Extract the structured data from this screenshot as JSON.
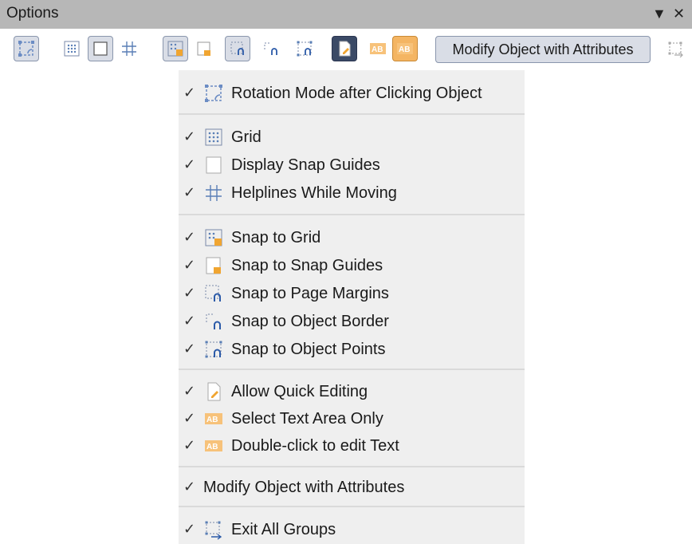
{
  "window": {
    "title": "Options",
    "dropdown_glyph": "▼",
    "close_glyph": "✕"
  },
  "toolbar": {
    "buttons": [
      {
        "name": "rotation-mode-button",
        "active": true,
        "icon": "rotation-mode-icon"
      },
      {
        "name": "grid-button",
        "active": false,
        "icon": "grid-icon"
      },
      {
        "name": "snap-guides-button",
        "active": true,
        "icon": "snap-guides-icon"
      },
      {
        "name": "helplines-button",
        "active": false,
        "icon": "helplines-icon"
      },
      {
        "name": "snap-to-grid-button",
        "active": true,
        "icon": "snap-to-grid-icon"
      },
      {
        "name": "snap-to-snap-guides-button",
        "active": false,
        "icon": "snap-to-snap-guides-icon"
      },
      {
        "name": "snap-to-page-margins-button",
        "active": true,
        "icon": "snap-to-page-margins-icon"
      },
      {
        "name": "snap-to-object-border-button",
        "active": false,
        "icon": "snap-to-object-border-icon"
      },
      {
        "name": "snap-to-object-points-button",
        "active": false,
        "icon": "snap-to-object-points-icon"
      },
      {
        "name": "allow-quick-editing-button",
        "active": true,
        "icon": "quick-edit-icon"
      },
      {
        "name": "select-text-area-only-button",
        "active": false,
        "icon": "text-area-icon"
      },
      {
        "name": "double-click-edit-text-button",
        "active": false,
        "icon": "text-edit-icon"
      },
      {
        "name": "exit-all-groups-button",
        "active": false,
        "icon": "exit-groups-icon"
      }
    ],
    "modify_label": "Modify Object with Attributes"
  },
  "menu": {
    "check_glyph": "✓",
    "items": [
      {
        "label": "Rotation Mode after Clicking Object",
        "icon": "rotation-mode-icon",
        "checked": true
      },
      {
        "label": "Grid",
        "icon": "grid-icon",
        "checked": true
      },
      {
        "label": "Display Snap Guides",
        "icon": "snap-guides-icon",
        "checked": true
      },
      {
        "label": "Helplines While Moving",
        "icon": "helplines-icon",
        "checked": true
      },
      {
        "label": "Snap to Grid",
        "icon": "snap-to-grid-icon",
        "checked": true
      },
      {
        "label": "Snap to Snap Guides",
        "icon": "snap-to-snap-guides-icon",
        "checked": true
      },
      {
        "label": "Snap to Page Margins",
        "icon": "snap-to-page-margins-icon",
        "checked": true
      },
      {
        "label": "Snap to Object Border",
        "icon": "snap-to-object-border-icon",
        "checked": true
      },
      {
        "label": "Snap to Object Points",
        "icon": "snap-to-object-points-icon",
        "checked": true
      },
      {
        "label": "Allow Quick Editing",
        "icon": "quick-edit-icon",
        "checked": true
      },
      {
        "label": "Select Text Area Only",
        "icon": "text-area-icon",
        "checked": true
      },
      {
        "label": "Double-click to edit Text",
        "icon": "text-edit-icon",
        "checked": true
      },
      {
        "label": "Modify Object with Attributes",
        "icon": "",
        "checked": true
      },
      {
        "label": "Exit All Groups",
        "icon": "exit-groups-icon",
        "checked": true
      }
    ]
  },
  "colors": {
    "titlebar": "#b7b7b7",
    "menu_bg": "#efefef",
    "active_bg": "#d9dde6",
    "active_border": "#8a96ad",
    "icon_blue": "#5a7fb6",
    "icon_orange": "#f0a531"
  }
}
